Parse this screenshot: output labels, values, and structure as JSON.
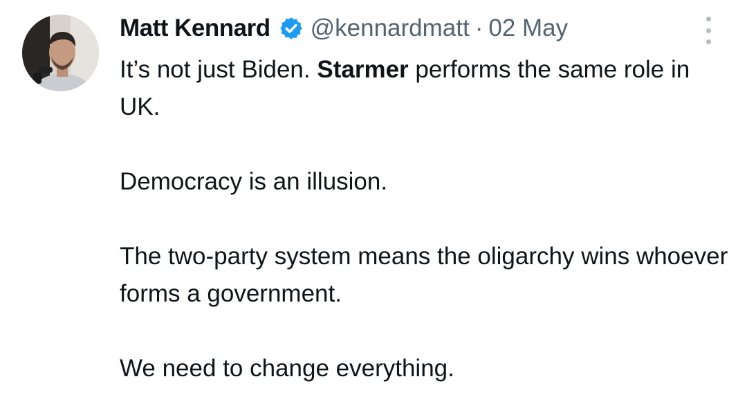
{
  "tweet": {
    "author": {
      "name": "Matt Kennard",
      "handle": "@kennardmatt",
      "verified_icon": "verified-badge-icon",
      "verified_color": "#1d9bf0"
    },
    "separator": "·",
    "date": "02 May",
    "more_icon": "more-options-icon",
    "body": {
      "p1_before": "It’s not just Biden. ",
      "p1_bold": "Starmer",
      "p1_after": " performs the same role in UK.",
      "p2": "Democracy is an illusion.",
      "p3": "The two-party system means the oligarchy wins whoever forms a government.",
      "p4": "We need to change everything."
    }
  },
  "colors": {
    "text": "#0f1419",
    "secondary": "#536471",
    "accent": "#1d9bf0",
    "background": "#ffffff"
  }
}
